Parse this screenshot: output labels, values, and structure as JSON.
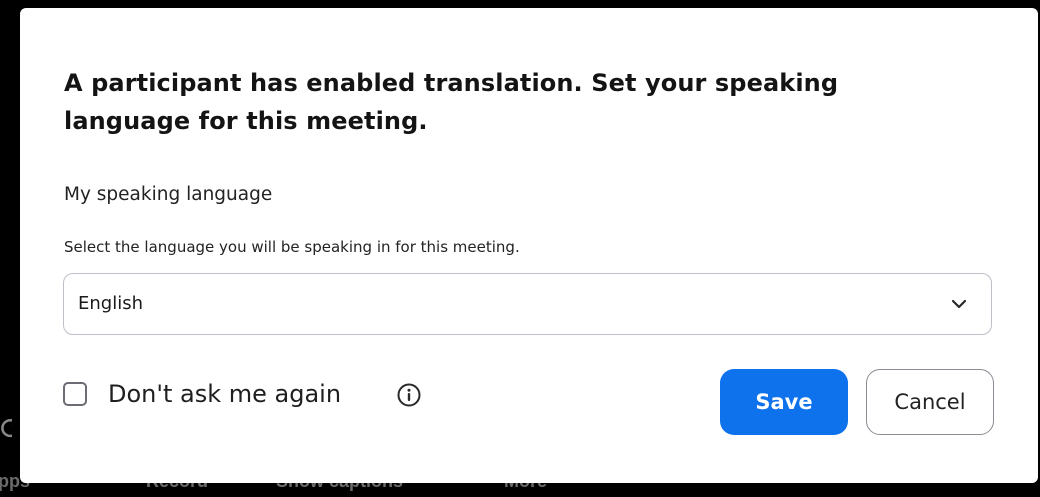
{
  "background": {
    "toolbar_items": [
      "pps",
      "Record",
      "Show captions",
      "More"
    ]
  },
  "dialog": {
    "title": "A participant has enabled translation. Set your speaking language for this meeting.",
    "section_label": "My speaking language",
    "help_text": "Select the language you will be speaking in for this meeting.",
    "language_select": {
      "selected": "English",
      "icon": "chevron-down-icon"
    },
    "dont_ask": {
      "label": "Don't ask me again",
      "checked": false,
      "info_icon": "info-icon"
    },
    "buttons": {
      "save": "Save",
      "cancel": "Cancel"
    }
  },
  "colors": {
    "accent": "#0e72ed",
    "dialog_background": "#ffffff",
    "backdrop": "#000000"
  }
}
